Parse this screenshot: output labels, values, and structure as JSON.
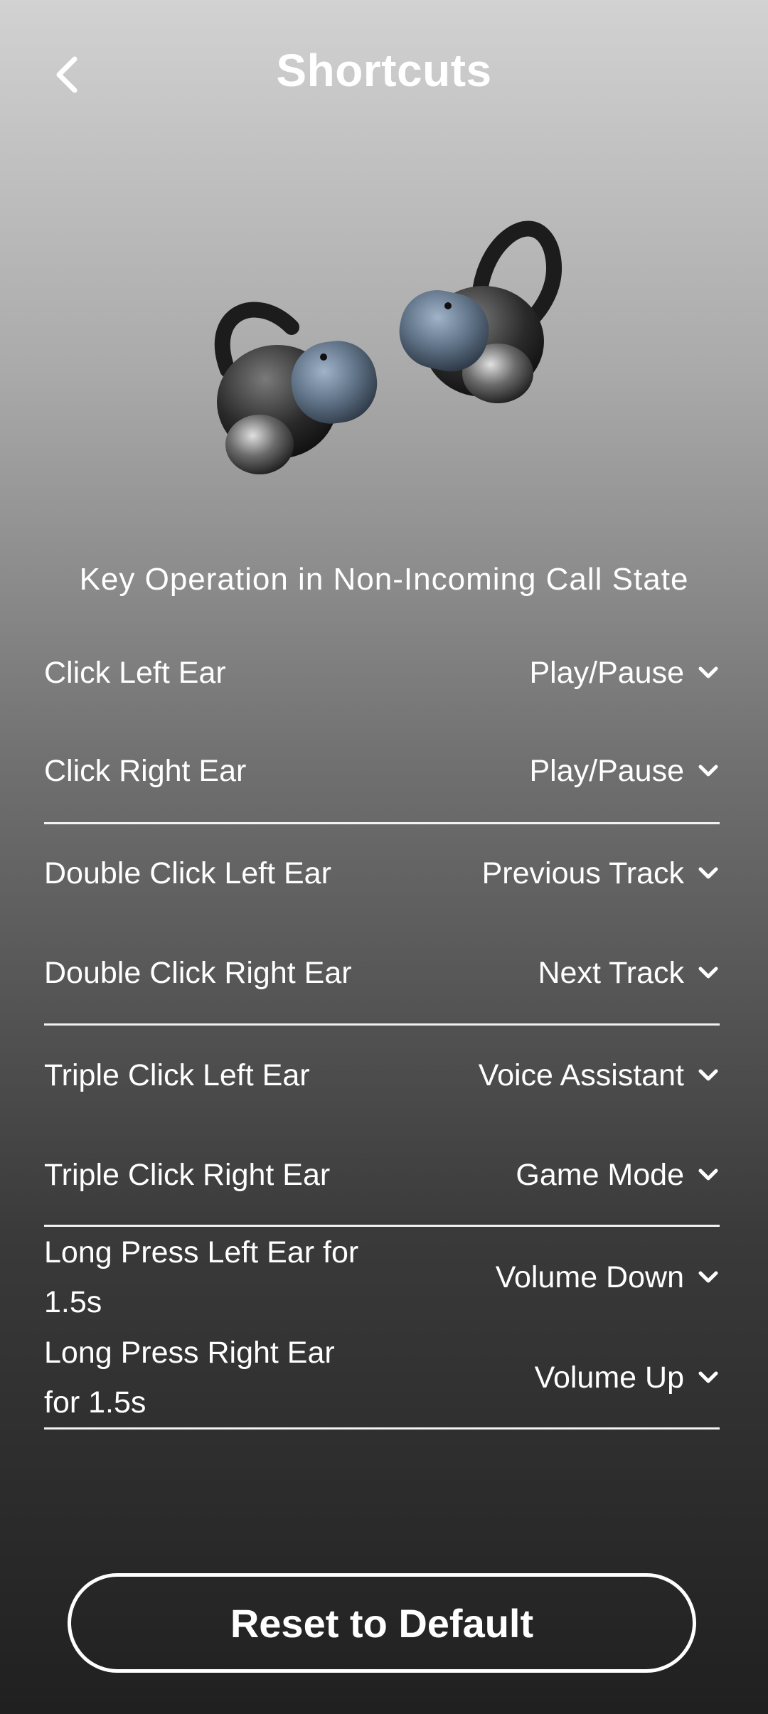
{
  "header": {
    "title": "Shortcuts"
  },
  "section": {
    "title": "Key Operation in Non-Incoming Call State"
  },
  "shortcuts": [
    {
      "label": "Click Left Ear",
      "value": "Play/Pause"
    },
    {
      "label": "Click Right Ear",
      "value": "Play/Pause"
    },
    {
      "label": "Double Click Left Ear",
      "value": "Previous Track"
    },
    {
      "label": "Double Click Right Ear",
      "value": "Next Track"
    },
    {
      "label": "Triple Click Left Ear",
      "value": "Voice Assistant"
    },
    {
      "label": "Triple Click Right Ear",
      "value": "Game Mode"
    },
    {
      "label": "Long Press Left Ear for 1.5s",
      "value": "Volume Down"
    },
    {
      "label": "Long Press Right Ear for 1.5s",
      "value": "Volume Up"
    }
  ],
  "footer": {
    "reset_label": "Reset to Default"
  },
  "icons": {
    "back": "chevron-left-icon",
    "dropdown": "chevron-down-icon"
  },
  "colors": {
    "text": "#ffffff",
    "bg_top": "#d2d2d2",
    "bg_bottom": "#202020"
  }
}
